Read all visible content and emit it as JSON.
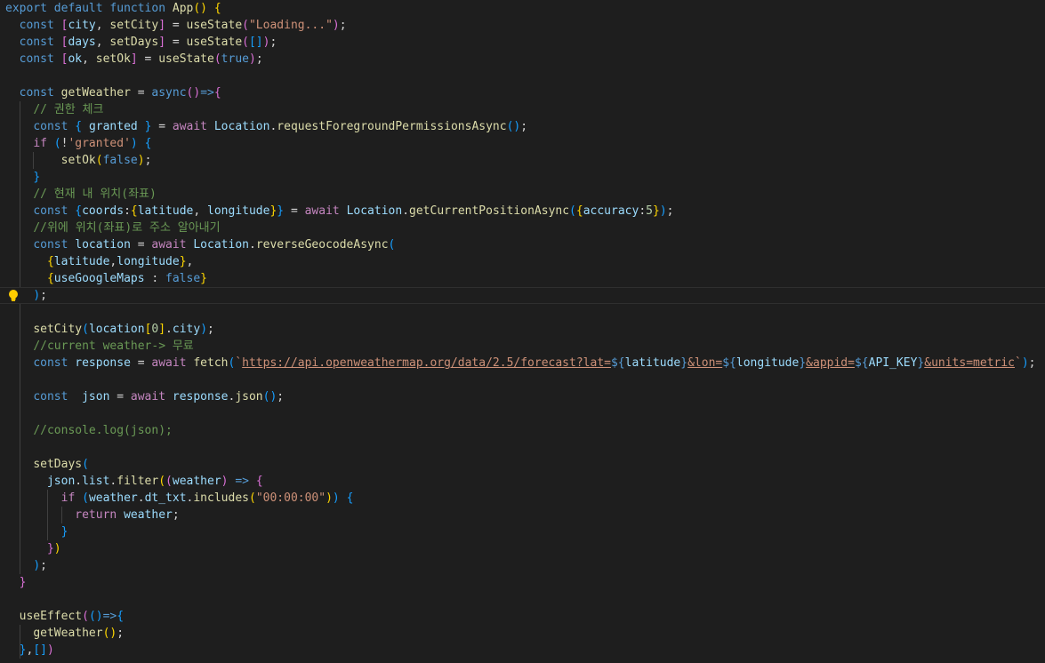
{
  "editor": {
    "lines": [
      {
        "segs": [
          [
            "k",
            "export"
          ],
          [
            "p",
            " "
          ],
          [
            "k",
            "default"
          ],
          [
            "p",
            " "
          ],
          [
            "k",
            "function"
          ],
          [
            "p",
            " "
          ],
          [
            "f",
            "App"
          ],
          [
            "b1",
            "()"
          ],
          [
            "p",
            " "
          ],
          [
            "b1",
            "{"
          ]
        ]
      },
      {
        "segs": [
          [
            "p",
            "  "
          ],
          [
            "k",
            "const"
          ],
          [
            "p",
            " "
          ],
          [
            "b2",
            "["
          ],
          [
            "v",
            "city"
          ],
          [
            "p",
            ", "
          ],
          [
            "f",
            "setCity"
          ],
          [
            "b2",
            "]"
          ],
          [
            "p",
            " = "
          ],
          [
            "f",
            "useState"
          ],
          [
            "b2",
            "("
          ],
          [
            "s",
            "\"Loading...\""
          ],
          [
            "b2",
            ")"
          ],
          [
            "p",
            ";"
          ]
        ]
      },
      {
        "segs": [
          [
            "p",
            "  "
          ],
          [
            "k",
            "const"
          ],
          [
            "p",
            " "
          ],
          [
            "b2",
            "["
          ],
          [
            "v",
            "days"
          ],
          [
            "p",
            ", "
          ],
          [
            "f",
            "setDays"
          ],
          [
            "b2",
            "]"
          ],
          [
            "p",
            " = "
          ],
          [
            "f",
            "useState"
          ],
          [
            "b2",
            "("
          ],
          [
            "b3",
            "[]"
          ],
          [
            "b2",
            ")"
          ],
          [
            "p",
            ";"
          ]
        ]
      },
      {
        "segs": [
          [
            "p",
            "  "
          ],
          [
            "k",
            "const"
          ],
          [
            "p",
            " "
          ],
          [
            "b2",
            "["
          ],
          [
            "v",
            "ok"
          ],
          [
            "p",
            ", "
          ],
          [
            "f",
            "setOk"
          ],
          [
            "b2",
            "]"
          ],
          [
            "p",
            " = "
          ],
          [
            "f",
            "useState"
          ],
          [
            "b2",
            "("
          ],
          [
            "k",
            "true"
          ],
          [
            "b2",
            ")"
          ],
          [
            "p",
            ";"
          ]
        ]
      },
      {
        "segs": []
      },
      {
        "segs": [
          [
            "p",
            "  "
          ],
          [
            "k",
            "const"
          ],
          [
            "p",
            " "
          ],
          [
            "f",
            "getWeather"
          ],
          [
            "p",
            " = "
          ],
          [
            "k",
            "async"
          ],
          [
            "b2",
            "()"
          ],
          [
            "k",
            "=>"
          ],
          [
            "b2",
            "{"
          ]
        ]
      },
      {
        "segs": [
          [
            "p",
            "    "
          ],
          [
            "cm",
            "// 권한 체크"
          ]
        ]
      },
      {
        "segs": [
          [
            "p",
            "    "
          ],
          [
            "k",
            "const"
          ],
          [
            "p",
            " "
          ],
          [
            "b3",
            "{"
          ],
          [
            "p",
            " "
          ],
          [
            "v",
            "granted"
          ],
          [
            "p",
            " "
          ],
          [
            "b3",
            "}"
          ],
          [
            "p",
            " = "
          ],
          [
            "c",
            "await"
          ],
          [
            "p",
            " "
          ],
          [
            "v",
            "Location"
          ],
          [
            "p",
            "."
          ],
          [
            "f",
            "requestForegroundPermissionsAsync"
          ],
          [
            "b3",
            "()"
          ],
          [
            "p",
            ";"
          ]
        ]
      },
      {
        "segs": [
          [
            "p",
            "    "
          ],
          [
            "c",
            "if"
          ],
          [
            "p",
            " "
          ],
          [
            "b3",
            "("
          ],
          [
            "p",
            "!"
          ],
          [
            "s",
            "'granted'"
          ],
          [
            "b3",
            ")"
          ],
          [
            "p",
            " "
          ],
          [
            "b3",
            "{"
          ]
        ]
      },
      {
        "segs": [
          [
            "p",
            "        "
          ],
          [
            "f",
            "setOk"
          ],
          [
            "b1",
            "("
          ],
          [
            "k",
            "false"
          ],
          [
            "b1",
            ")"
          ],
          [
            "p",
            ";"
          ]
        ]
      },
      {
        "segs": [
          [
            "p",
            "    "
          ],
          [
            "b3",
            "}"
          ]
        ]
      },
      {
        "segs": [
          [
            "p",
            "    "
          ],
          [
            "cm",
            "// 현재 내 위치(좌표)"
          ]
        ]
      },
      {
        "segs": [
          [
            "p",
            "    "
          ],
          [
            "k",
            "const"
          ],
          [
            "p",
            " "
          ],
          [
            "b3",
            "{"
          ],
          [
            "v",
            "coords"
          ],
          [
            "p",
            ":"
          ],
          [
            "b1",
            "{"
          ],
          [
            "v",
            "latitude"
          ],
          [
            "p",
            ", "
          ],
          [
            "v",
            "longitude"
          ],
          [
            "b1",
            "}"
          ],
          [
            "b3",
            "}"
          ],
          [
            "p",
            " = "
          ],
          [
            "c",
            "await"
          ],
          [
            "p",
            " "
          ],
          [
            "v",
            "Location"
          ],
          [
            "p",
            "."
          ],
          [
            "f",
            "getCurrentPositionAsync"
          ],
          [
            "b3",
            "("
          ],
          [
            "b1",
            "{"
          ],
          [
            "v",
            "accuracy"
          ],
          [
            "p",
            ":"
          ],
          [
            "n",
            "5"
          ],
          [
            "b1",
            "}"
          ],
          [
            "b3",
            ")"
          ],
          [
            "p",
            ";"
          ]
        ]
      },
      {
        "segs": [
          [
            "p",
            "    "
          ],
          [
            "cm",
            "//위에 위치(좌표)로 주소 알아내기"
          ]
        ]
      },
      {
        "segs": [
          [
            "p",
            "    "
          ],
          [
            "k",
            "const"
          ],
          [
            "p",
            " "
          ],
          [
            "v",
            "location"
          ],
          [
            "p",
            " = "
          ],
          [
            "c",
            "await"
          ],
          [
            "p",
            " "
          ],
          [
            "v",
            "Location"
          ],
          [
            "p",
            "."
          ],
          [
            "f",
            "reverseGeocodeAsync"
          ],
          [
            "b3",
            "("
          ]
        ]
      },
      {
        "segs": [
          [
            "p",
            "      "
          ],
          [
            "b1",
            "{"
          ],
          [
            "v",
            "latitude"
          ],
          [
            "p",
            ","
          ],
          [
            "v",
            "longitude"
          ],
          [
            "b1",
            "}"
          ],
          [
            "p",
            ","
          ]
        ]
      },
      {
        "segs": [
          [
            "p",
            "      "
          ],
          [
            "b1",
            "{"
          ],
          [
            "v",
            "useGoogleMaps"
          ],
          [
            "p",
            " : "
          ],
          [
            "k",
            "false"
          ],
          [
            "b1",
            "}"
          ]
        ]
      },
      {
        "segs": [
          [
            "p",
            "    "
          ],
          [
            "b3",
            ")"
          ],
          [
            "p",
            ";"
          ]
        ],
        "current": true,
        "bulb": true
      },
      {
        "segs": []
      },
      {
        "segs": [
          [
            "p",
            "    "
          ],
          [
            "f",
            "setCity"
          ],
          [
            "b3",
            "("
          ],
          [
            "v",
            "location"
          ],
          [
            "b1",
            "["
          ],
          [
            "n",
            "0"
          ],
          [
            "b1",
            "]"
          ],
          [
            "p",
            "."
          ],
          [
            "v",
            "city"
          ],
          [
            "b3",
            ")"
          ],
          [
            "p",
            ";"
          ]
        ]
      },
      {
        "segs": [
          [
            "p",
            "    "
          ],
          [
            "cm",
            "//current weather-> 무료"
          ]
        ]
      },
      {
        "segs": [
          [
            "p",
            "    "
          ],
          [
            "k",
            "const"
          ],
          [
            "p",
            " "
          ],
          [
            "v",
            "response"
          ],
          [
            "p",
            " = "
          ],
          [
            "c",
            "await"
          ],
          [
            "p",
            " "
          ],
          [
            "f",
            "fetch"
          ],
          [
            "b3",
            "("
          ],
          [
            "s",
            "`"
          ],
          [
            "su",
            "https://api.openweathermap.org/data/2.5/forecast?lat="
          ],
          [
            "k",
            "${"
          ],
          [
            "v",
            "latitude"
          ],
          [
            "k",
            "}"
          ],
          [
            "su",
            "&lon="
          ],
          [
            "k",
            "${"
          ],
          [
            "v",
            "longitude"
          ],
          [
            "k",
            "}"
          ],
          [
            "su",
            "&appid="
          ],
          [
            "k",
            "${"
          ],
          [
            "v",
            "API_KEY"
          ],
          [
            "k",
            "}"
          ],
          [
            "su",
            "&units=metric"
          ],
          [
            "s",
            "`"
          ],
          [
            "b3",
            ")"
          ],
          [
            "p",
            ";"
          ]
        ]
      },
      {
        "segs": []
      },
      {
        "segs": [
          [
            "p",
            "    "
          ],
          [
            "k",
            "const"
          ],
          [
            "p",
            "  "
          ],
          [
            "v",
            "json"
          ],
          [
            "p",
            " = "
          ],
          [
            "c",
            "await"
          ],
          [
            "p",
            " "
          ],
          [
            "v",
            "response"
          ],
          [
            "p",
            "."
          ],
          [
            "f",
            "json"
          ],
          [
            "b3",
            "()"
          ],
          [
            "p",
            ";"
          ]
        ]
      },
      {
        "segs": []
      },
      {
        "segs": [
          [
            "p",
            "    "
          ],
          [
            "cm",
            "//console.log(json);"
          ]
        ]
      },
      {
        "segs": []
      },
      {
        "segs": [
          [
            "p",
            "    "
          ],
          [
            "f",
            "setDays"
          ],
          [
            "b3",
            "("
          ]
        ]
      },
      {
        "segs": [
          [
            "p",
            "      "
          ],
          [
            "v",
            "json"
          ],
          [
            "p",
            "."
          ],
          [
            "v",
            "list"
          ],
          [
            "p",
            "."
          ],
          [
            "f",
            "filter"
          ],
          [
            "b1",
            "("
          ],
          [
            "b2",
            "("
          ],
          [
            "v",
            "weather"
          ],
          [
            "b2",
            ")"
          ],
          [
            "p",
            " "
          ],
          [
            "k",
            "=>"
          ],
          [
            "p",
            " "
          ],
          [
            "b2",
            "{"
          ]
        ]
      },
      {
        "segs": [
          [
            "p",
            "        "
          ],
          [
            "c",
            "if"
          ],
          [
            "p",
            " "
          ],
          [
            "b3",
            "("
          ],
          [
            "v",
            "weather"
          ],
          [
            "p",
            "."
          ],
          [
            "v",
            "dt_txt"
          ],
          [
            "p",
            "."
          ],
          [
            "f",
            "includes"
          ],
          [
            "b1",
            "("
          ],
          [
            "s",
            "\"00:00:00\""
          ],
          [
            "b1",
            ")"
          ],
          [
            "b3",
            ")"
          ],
          [
            "p",
            " "
          ],
          [
            "b3",
            "{"
          ]
        ]
      },
      {
        "segs": [
          [
            "p",
            "          "
          ],
          [
            "c",
            "return"
          ],
          [
            "p",
            " "
          ],
          [
            "v",
            "weather"
          ],
          [
            "p",
            ";"
          ]
        ]
      },
      {
        "segs": [
          [
            "p",
            "        "
          ],
          [
            "b3",
            "}"
          ]
        ]
      },
      {
        "segs": [
          [
            "p",
            "      "
          ],
          [
            "b2",
            "}"
          ],
          [
            "b1",
            ")"
          ]
        ]
      },
      {
        "segs": [
          [
            "p",
            "    "
          ],
          [
            "b3",
            ")"
          ],
          [
            "p",
            ";"
          ]
        ]
      },
      {
        "segs": [
          [
            "p",
            "  "
          ],
          [
            "b2",
            "}"
          ]
        ]
      },
      {
        "segs": []
      },
      {
        "segs": [
          [
            "p",
            "  "
          ],
          [
            "f",
            "useEffect"
          ],
          [
            "b2",
            "("
          ],
          [
            "b3",
            "()"
          ],
          [
            "k",
            "=>"
          ],
          [
            "b3",
            "{"
          ]
        ]
      },
      {
        "segs": [
          [
            "p",
            "    "
          ],
          [
            "f",
            "getWeather"
          ],
          [
            "b1",
            "()"
          ],
          [
            "p",
            ";"
          ]
        ]
      },
      {
        "segs": [
          [
            "p",
            "  "
          ],
          [
            "b3",
            "}"
          ],
          [
            "p",
            ","
          ],
          [
            "b3",
            "[]"
          ],
          [
            "b2",
            ")"
          ]
        ]
      }
    ],
    "guides": [
      {
        "col": 2,
        "from": 6,
        "to": 16
      },
      {
        "col": 2,
        "from": 18,
        "to": 33
      },
      {
        "col": 2,
        "from": 37,
        "to": 38
      },
      {
        "col": 4,
        "from": 9,
        "to": 9
      },
      {
        "col": 6,
        "from": 29,
        "to": 31
      },
      {
        "col": 8,
        "from": 30,
        "to": 30
      }
    ]
  }
}
